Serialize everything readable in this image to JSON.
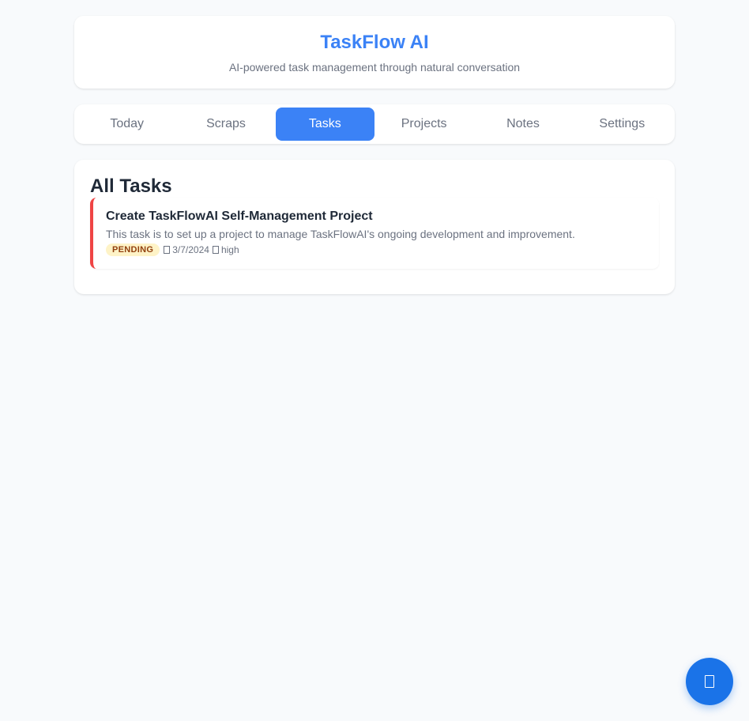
{
  "header": {
    "title": "TaskFlow AI",
    "subtitle": "AI-powered task management through natural conversation"
  },
  "nav": {
    "tabs": [
      {
        "label": "Today",
        "active": false
      },
      {
        "label": "Scraps",
        "active": false
      },
      {
        "label": "Tasks",
        "active": true
      },
      {
        "label": "Projects",
        "active": false
      },
      {
        "label": "Notes",
        "active": false
      },
      {
        "label": "Settings",
        "active": false
      }
    ]
  },
  "main": {
    "section_title": "All Tasks",
    "tasks": [
      {
        "title": "Create TaskFlowAI Self-Management Project",
        "description": "This task is to set up a project to manage TaskFlowAI's ongoing development and improvement.",
        "status": "PENDING",
        "date": "3/7/2024",
        "priority": "high",
        "date_icon": "calendar-icon",
        "priority_icon": "priority-icon",
        "border_color": "#ef4444"
      }
    ]
  },
  "fab": {
    "icon": "chat-icon",
    "color": "#1a73e8"
  },
  "colors": {
    "accent": "#3b82f6",
    "background": "#f8fafc",
    "status_pending_bg": "#fef3c7",
    "status_pending_text": "#92400e"
  }
}
